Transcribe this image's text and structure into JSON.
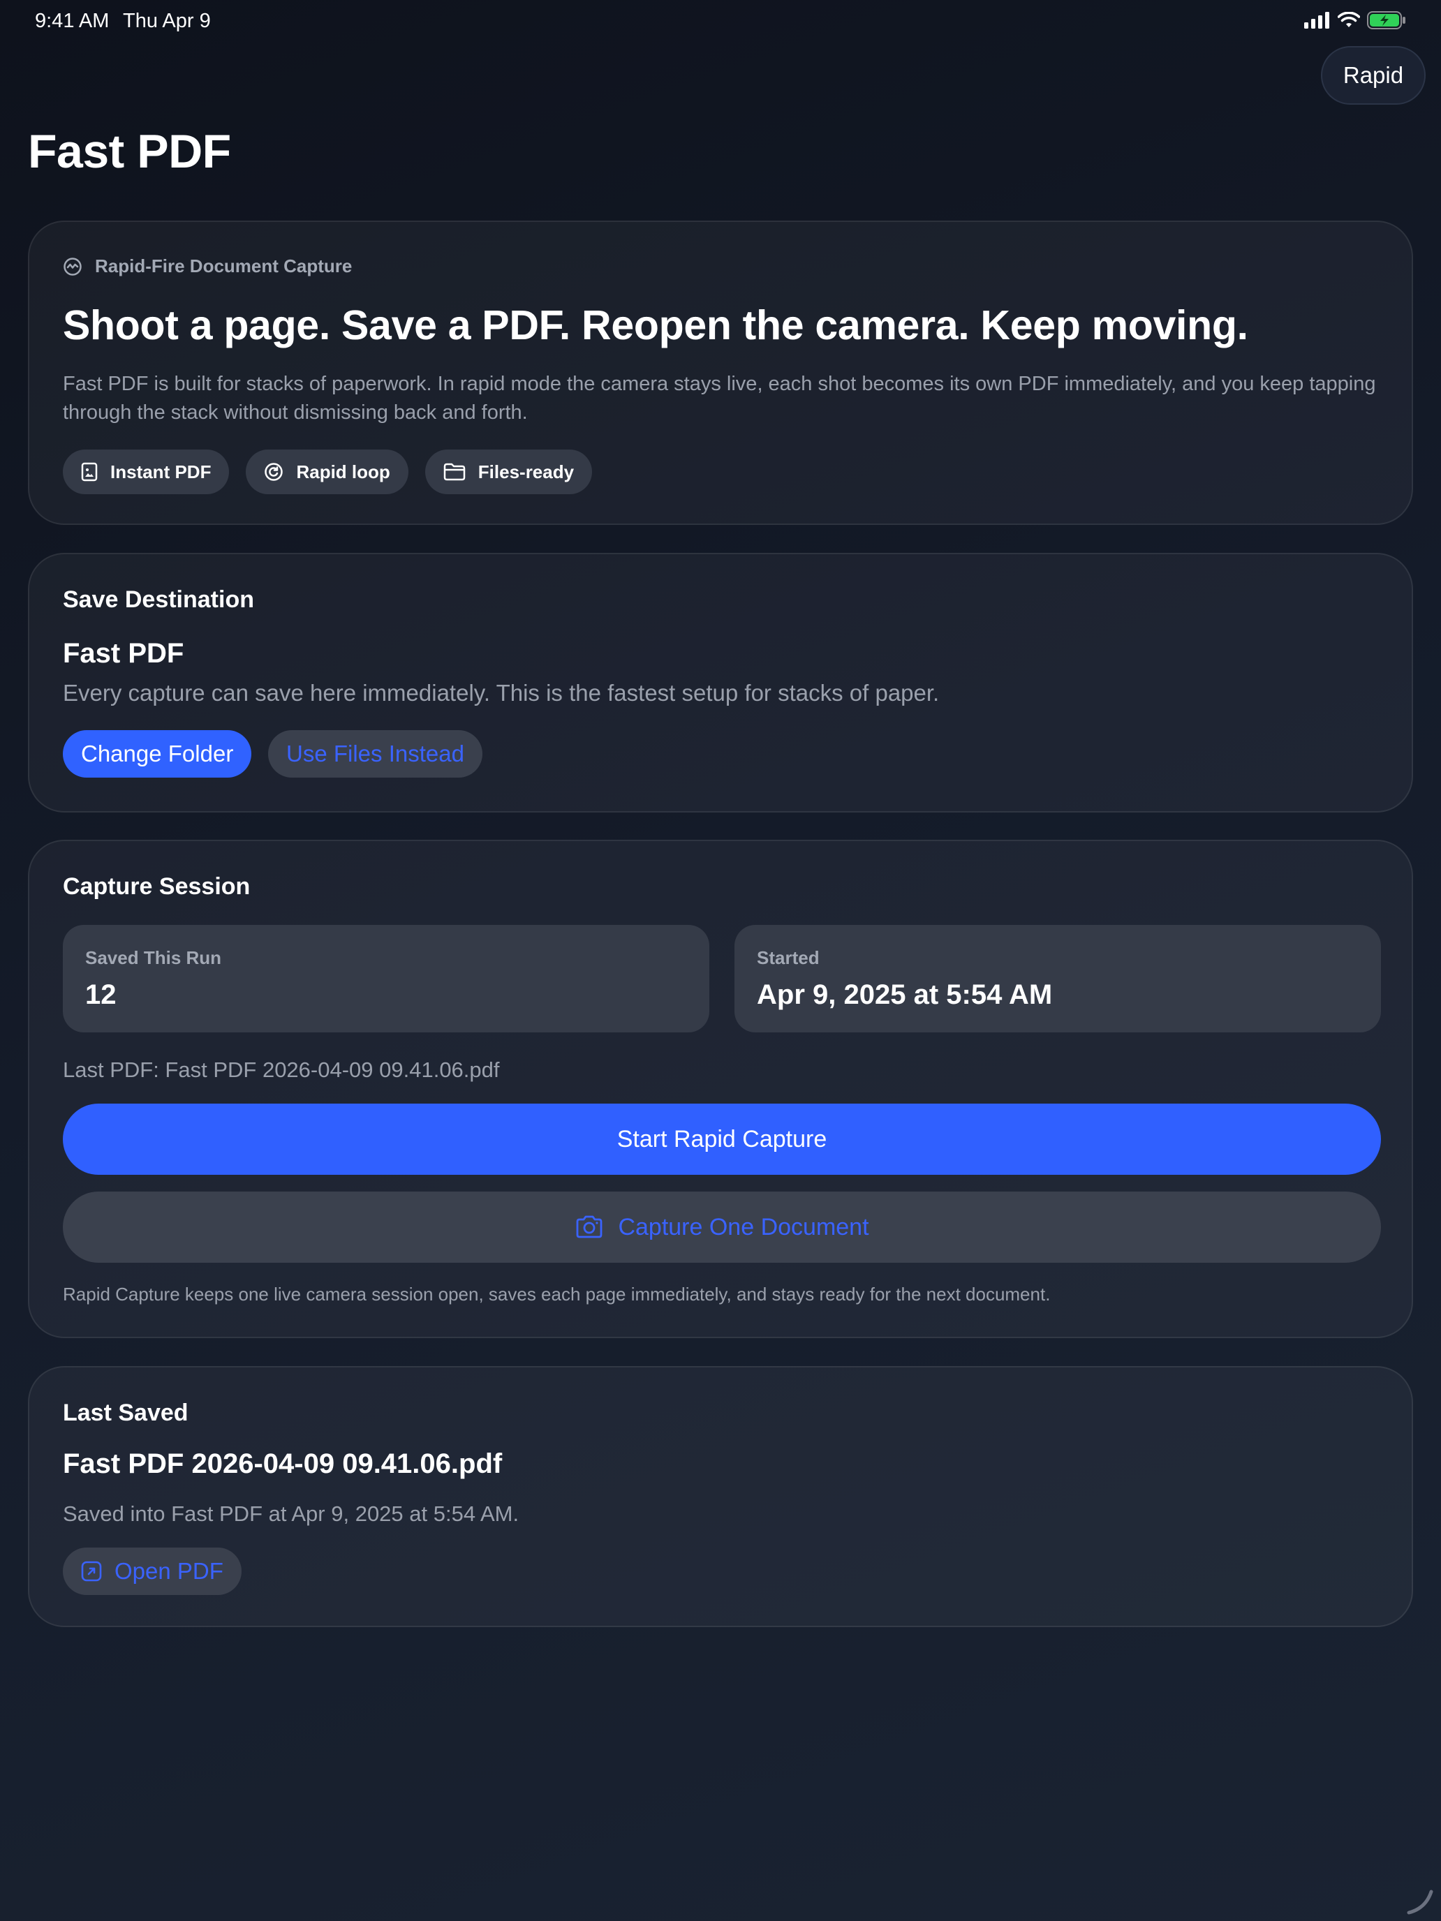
{
  "status_bar": {
    "time": "9:41 AM",
    "date": "Thu Apr 9",
    "icons": [
      "cellular-signal-icon",
      "wifi-icon",
      "battery-charging-icon"
    ],
    "battery_color": "#30d158"
  },
  "mode_pill": {
    "label": "Rapid"
  },
  "page": {
    "title": "Fast PDF"
  },
  "hero": {
    "eyebrow": "Rapid-Fire Document Capture",
    "eyebrow_icon": "waveform-circle-icon",
    "headline": "Shoot a page. Save a PDF. Reopen the camera. Keep moving.",
    "body": "Fast PDF is built for stacks of paperwork. In rapid mode the camera stays live, each shot becomes its own PDF immediately, and you keep tapping through the stack without dismissing back and forth.",
    "chips": [
      {
        "label": "Instant PDF",
        "icon": "document-image-icon"
      },
      {
        "label": "Rapid loop",
        "icon": "loop-circle-icon"
      },
      {
        "label": "Files-ready",
        "icon": "folder-icon"
      }
    ]
  },
  "save_destination": {
    "heading": "Save Destination",
    "folder_name": "Fast PDF",
    "description": "Every capture can save here immediately. This is the fastest setup for stacks of paper.",
    "change_folder_label": "Change Folder",
    "use_files_label": "Use Files Instead"
  },
  "capture_session": {
    "heading": "Capture Session",
    "saved_label": "Saved This Run",
    "saved_value": "12",
    "started_label": "Started",
    "started_value": "Apr 9, 2025 at 5:54 AM",
    "last_pdf": "Last PDF: Fast PDF 2026-04-09 09.41.06.pdf",
    "start_button": "Start Rapid Capture",
    "one_button": "Capture One Document",
    "one_button_icon": "camera-icon",
    "footnote": "Rapid Capture keeps one live camera session open, saves each page immediately, and stays ready for the next document."
  },
  "last_saved": {
    "heading": "Last Saved",
    "filename": "Fast PDF 2026-04-09 09.41.06.pdf",
    "detail": "Saved into Fast PDF at Apr 9, 2025 at 5:54 AM.",
    "open_button": "Open PDF",
    "open_icon": "open-external-icon"
  },
  "colors": {
    "accent": "#3062ff",
    "accent_text": "#3a63ff",
    "card_bg": "#1e2431",
    "secondary_text": "#9aa0ac"
  }
}
